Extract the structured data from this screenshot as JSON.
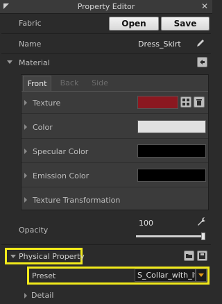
{
  "window": {
    "title": "Property Editor",
    "close_glyph": "✕"
  },
  "fabric": {
    "label": "Fabric",
    "open_label": "Open",
    "save_label": "Save"
  },
  "name": {
    "label": "Name",
    "value": "Dress_Skirt"
  },
  "material": {
    "label": "Material",
    "tabs": [
      {
        "label": "Front",
        "active": true
      },
      {
        "label": "Back",
        "active": false
      },
      {
        "label": "Side",
        "active": false
      }
    ],
    "properties": [
      {
        "label": "Texture",
        "color": "#8b1820"
      },
      {
        "label": "Color",
        "color": "#e1e1e1"
      },
      {
        "label": "Specular Color",
        "color": "#000000"
      },
      {
        "label": "Emission Color",
        "color": "#000000"
      },
      {
        "label": "Texture Transformation"
      }
    ]
  },
  "opacity": {
    "label": "Opacity",
    "value": "100",
    "level": 1.0
  },
  "physical_property": {
    "label": "Physical Property",
    "preset_label": "Preset",
    "preset_value": "S_Collar_with_It",
    "detail_label": "Detail"
  },
  "colors": {
    "highlight": "#f2ea1b",
    "dropdown_arrow": "#e39a1a"
  }
}
